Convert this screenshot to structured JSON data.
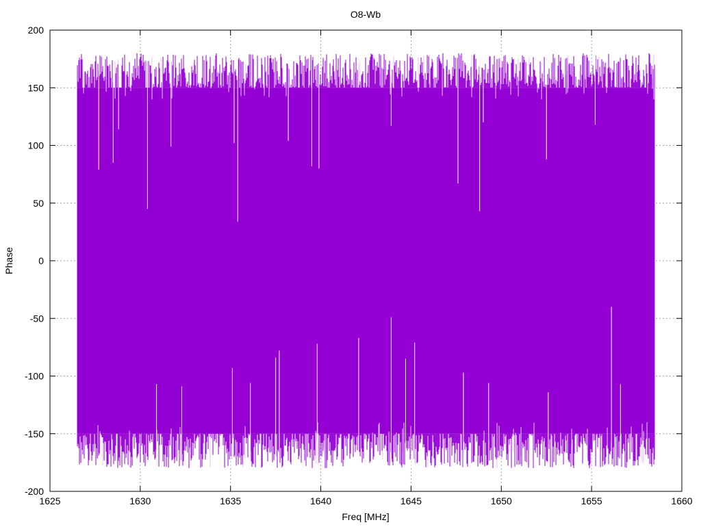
{
  "chart_data": {
    "type": "line",
    "title": "O8-Wb",
    "xlabel": "Freq [MHz]",
    "ylabel": "Phase",
    "xlim": [
      1625,
      1660
    ],
    "ylim": [
      -200,
      200
    ],
    "xticks": [
      1625,
      1630,
      1635,
      1640,
      1645,
      1650,
      1655,
      1660
    ],
    "yticks": [
      -200,
      -150,
      -100,
      -50,
      0,
      50,
      100,
      150,
      200
    ],
    "grid": true,
    "legend": "none",
    "series": [
      {
        "name": "phase",
        "color": "#9400d3",
        "x_start": 1626.5,
        "x_end": 1658.5,
        "typical_upper": [
          150,
          180
        ],
        "typical_lower": [
          -180,
          -150
        ],
        "upper_dips": [
          {
            "x": 1627.7,
            "y": 79
          },
          {
            "x": 1628.5,
            "y": 85
          },
          {
            "x": 1628.8,
            "y": 114
          },
          {
            "x": 1630.4,
            "y": 45
          },
          {
            "x": 1631.7,
            "y": 99
          },
          {
            "x": 1635.2,
            "y": 102
          },
          {
            "x": 1635.4,
            "y": 34
          },
          {
            "x": 1638.2,
            "y": 104
          },
          {
            "x": 1639.5,
            "y": 82
          },
          {
            "x": 1639.9,
            "y": 80
          },
          {
            "x": 1643.9,
            "y": 117
          },
          {
            "x": 1647.6,
            "y": 67
          },
          {
            "x": 1648.8,
            "y": 43
          },
          {
            "x": 1649.0,
            "y": 120
          },
          {
            "x": 1652.5,
            "y": 88
          },
          {
            "x": 1655.2,
            "y": 118
          }
        ],
        "lower_peaks": [
          {
            "x": 1630.9,
            "y": -107
          },
          {
            "x": 1632.3,
            "y": -109
          },
          {
            "x": 1635.1,
            "y": -93
          },
          {
            "x": 1636.1,
            "y": -106
          },
          {
            "x": 1637.5,
            "y": -84
          },
          {
            "x": 1637.7,
            "y": -78
          },
          {
            "x": 1639.8,
            "y": -72
          },
          {
            "x": 1642.1,
            "y": -67
          },
          {
            "x": 1643.9,
            "y": -49
          },
          {
            "x": 1644.7,
            "y": -85
          },
          {
            "x": 1645.2,
            "y": -71
          },
          {
            "x": 1647.9,
            "y": -97
          },
          {
            "x": 1649.3,
            "y": -106
          },
          {
            "x": 1652.6,
            "y": -114
          },
          {
            "x": 1656.1,
            "y": -40
          },
          {
            "x": 1656.6,
            "y": -107
          }
        ]
      }
    ]
  }
}
